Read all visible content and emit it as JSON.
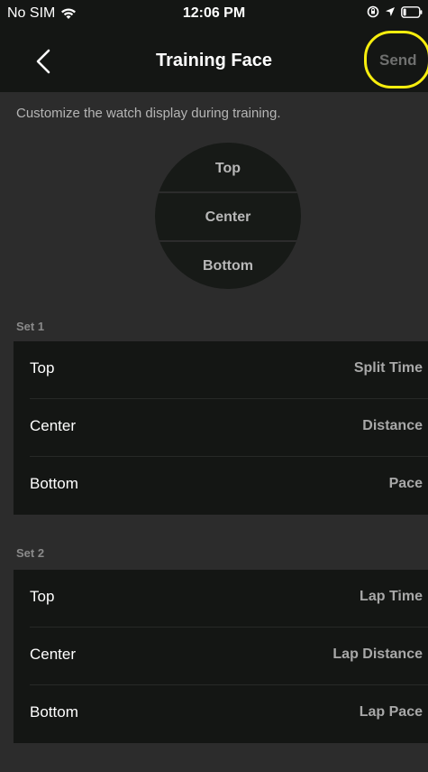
{
  "status_bar": {
    "carrier": "No SIM",
    "time": "12:06 PM"
  },
  "nav": {
    "title": "Training Face",
    "send_label": "Send",
    "highlight_color": "#f7ee0e"
  },
  "intro_text": "Customize the watch display during training.",
  "dial": {
    "top": "Top",
    "center": "Center",
    "bottom": "Bottom"
  },
  "sets": [
    {
      "label": "Set 1",
      "rows": [
        {
          "position": "Top",
          "value": "Split Time"
        },
        {
          "position": "Center",
          "value": "Distance"
        },
        {
          "position": "Bottom",
          "value": "Pace"
        }
      ]
    },
    {
      "label": "Set 2",
      "rows": [
        {
          "position": "Top",
          "value": "Lap Time"
        },
        {
          "position": "Center",
          "value": "Lap Distance"
        },
        {
          "position": "Bottom",
          "value": "Lap Pace"
        }
      ]
    }
  ]
}
